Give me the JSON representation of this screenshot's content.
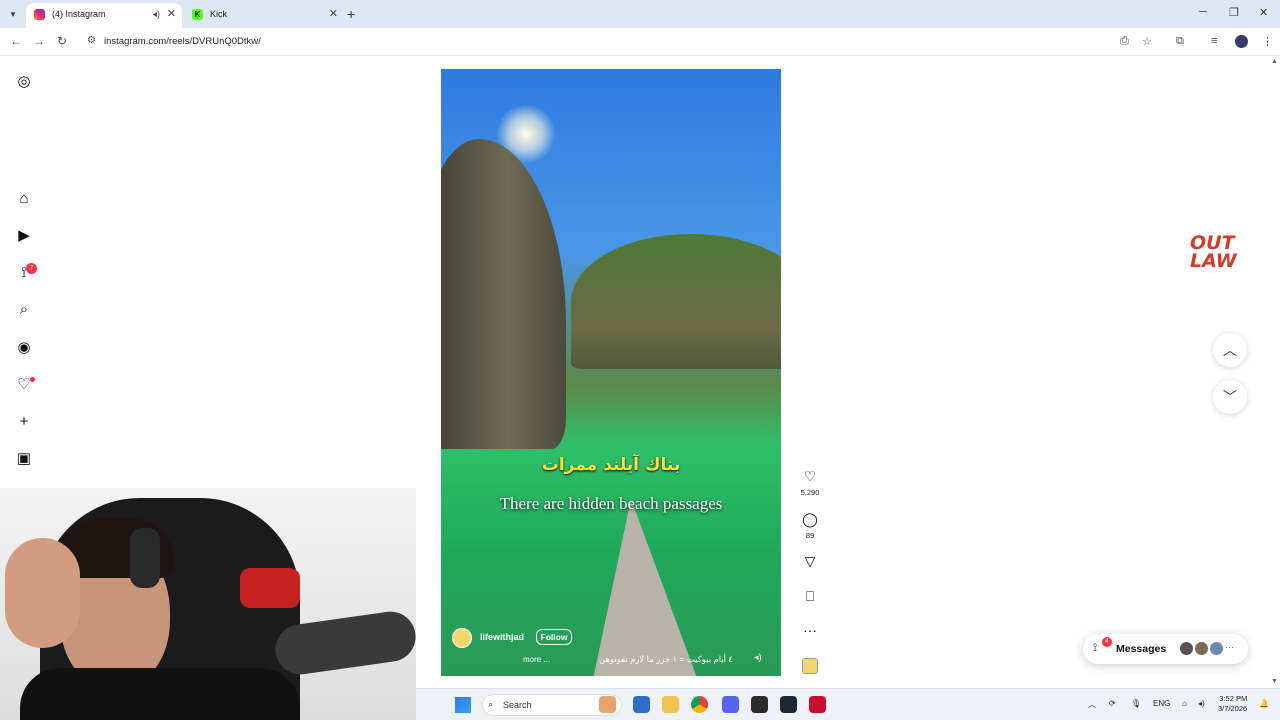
{
  "browser": {
    "tabs": [
      {
        "title": "(4) Instagram"
      },
      {
        "title": "Kick"
      }
    ],
    "url": "instagram.com/reels/DVRUnQ0Dtkw/"
  },
  "sidebar": {
    "notifications_badge": "7"
  },
  "reel": {
    "caption_arabic": "بناك آيلند ممرات",
    "caption_english": "There are hidden beach passages",
    "username": "lifewithjad",
    "follow_label": "Follow",
    "description": "٤ أيام ببوكيت = ١ جزر ما لازم تفوتوهن",
    "more_label": "more ...",
    "likes": "5,290",
    "comments": "89"
  },
  "overlay": {
    "logo_text_line1": "OUT",
    "logo_text_line2": "LAW"
  },
  "messages": {
    "label": "Messages",
    "badge": "4"
  },
  "taskbar": {
    "search_placeholder": "Search",
    "language": "ENG",
    "time": "3:52 PM",
    "date": "3/7/2026"
  }
}
